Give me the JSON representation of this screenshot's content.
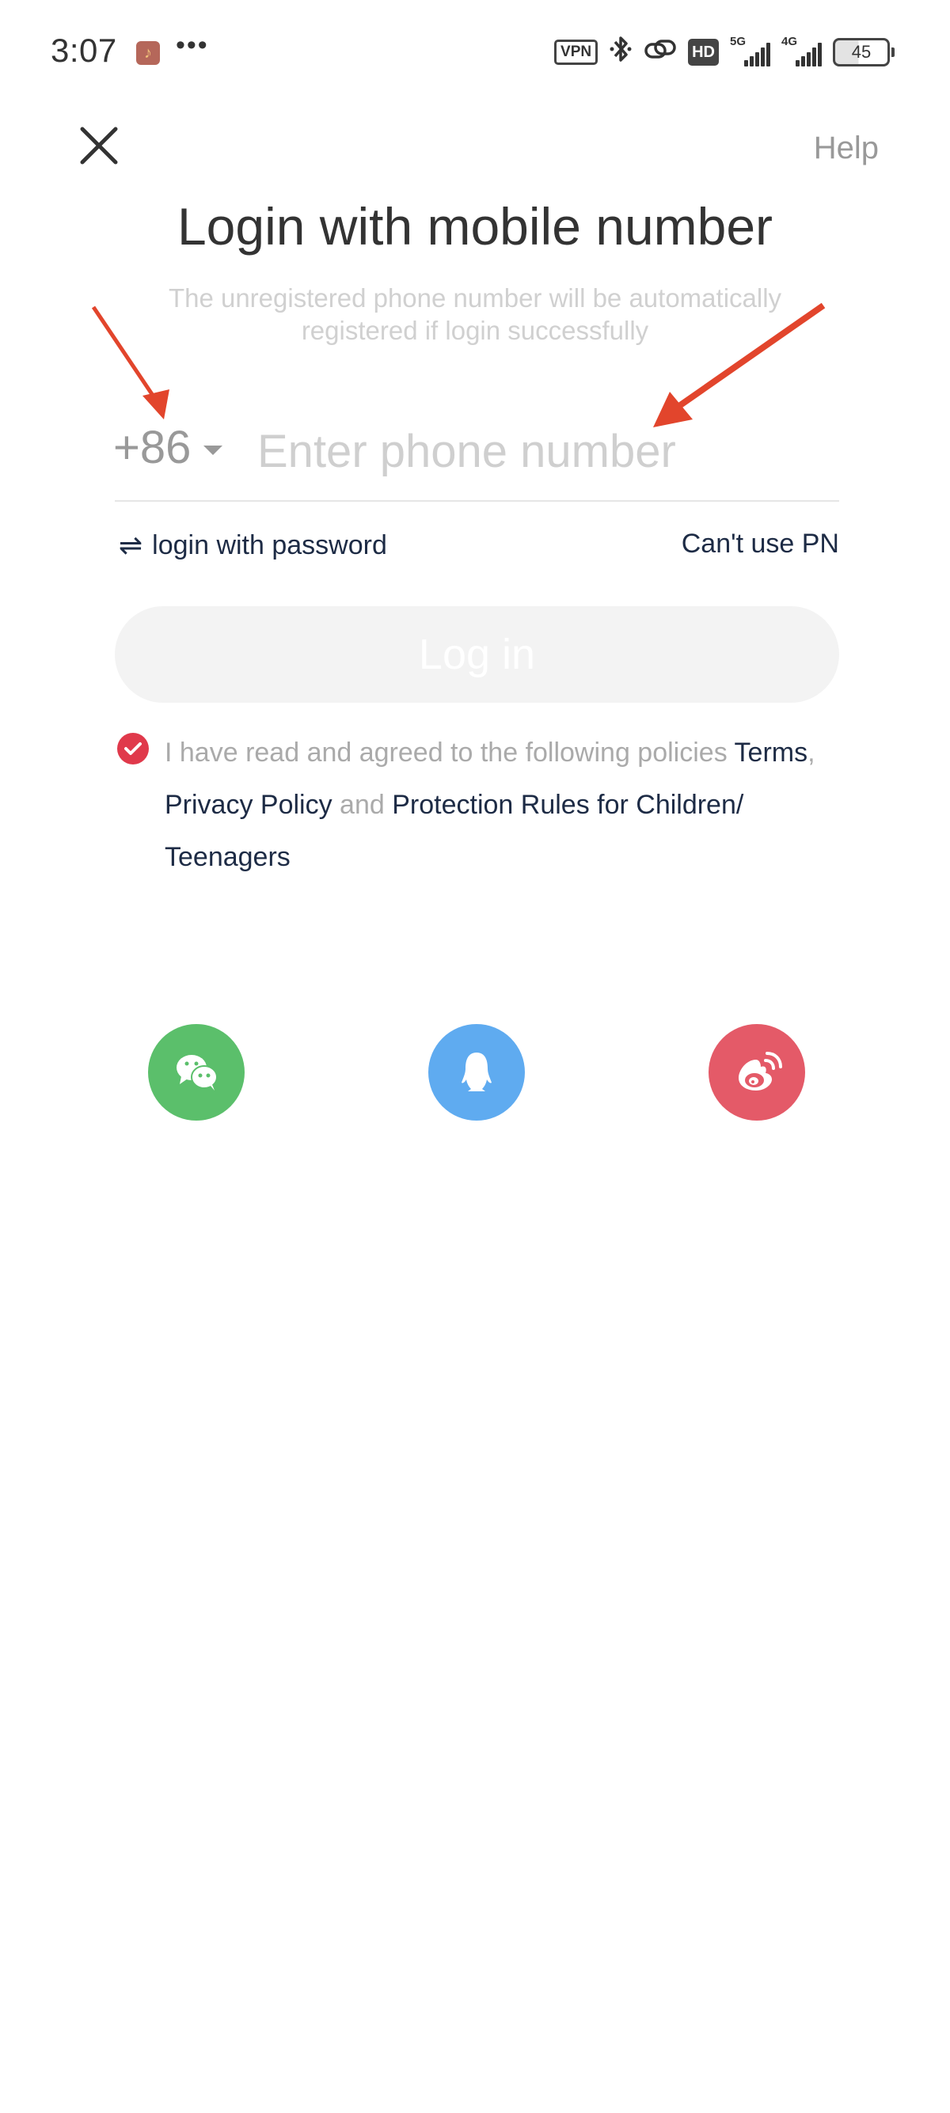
{
  "status_bar": {
    "time": "3:07",
    "notification_icon": "music-note-icon",
    "overflow": "•••",
    "vpn_label": "VPN",
    "bluetooth_icon": "bluetooth-icon",
    "link_icon": "link-icon",
    "hd_label": "HD",
    "sim1_label": "5G",
    "sim2_label": "4G",
    "battery_level": "45"
  },
  "header": {
    "close_icon": "close-icon",
    "help_label": "Help",
    "title": "Login with mobile number",
    "subtitle": "The unregistered phone number will be automatically registered if login successfully"
  },
  "phone": {
    "country_code": "+86",
    "value": "",
    "placeholder": "Enter phone number"
  },
  "links": {
    "password_login": "login with password",
    "password_icon": "switch-arrows-icon",
    "cant_use": "Can't use PN"
  },
  "login_button": "Log in",
  "policy": {
    "checked": true,
    "prefix": "I have read and agreed to the following policies ",
    "terms": "Terms",
    "comma": ",",
    "privacy": "Privacy Policy",
    "and": " and ",
    "protection": "Protection Rules for Children/ Teenagers"
  },
  "social_logins": [
    {
      "name": "WeChat",
      "icon": "wechat-icon",
      "color": "#5bbf6b"
    },
    {
      "name": "QQ",
      "icon": "qq-penguin-icon",
      "color": "#5fabf0"
    },
    {
      "name": "Weibo",
      "icon": "weibo-icon",
      "color": "#e45a68"
    }
  ],
  "colors": {
    "accent_dark": "#1d2b45",
    "check_red": "#e0394b",
    "annotation_arrow": "#e2452c"
  }
}
